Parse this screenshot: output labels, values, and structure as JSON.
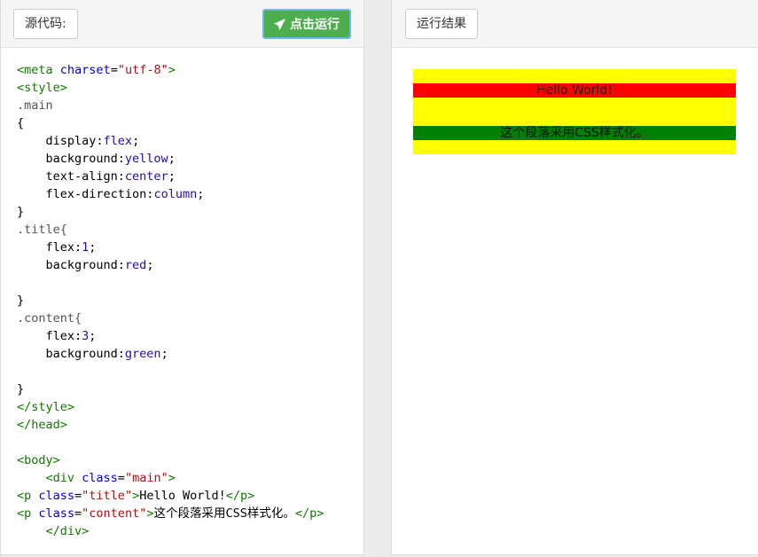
{
  "left_panel": {
    "source_label": "源代码:",
    "run_label": "点击运行",
    "code": {
      "l1_a": "<meta ",
      "l1_b": "charset",
      "l1_c": "=",
      "l1_d": "\"utf-8\"",
      "l1_e": ">",
      "l2": "<style>",
      "l3": ".main",
      "l4": "{",
      "l5_a": "    display:",
      "l5_b": "flex",
      "l5_c": ";",
      "l6_a": "    background:",
      "l6_b": "yellow",
      "l6_c": ";",
      "l7_a": "    text-align:",
      "l7_b": "center",
      "l7_c": ";",
      "l8_a": "    flex-direction:",
      "l8_b": "column",
      "l8_c": ";",
      "l9": "}",
      "l10": ".title{",
      "l11_a": "    flex:",
      "l11_b": "1",
      "l11_c": ";",
      "l12_a": "    background:",
      "l12_b": "red",
      "l12_c": ";",
      "l14": "}",
      "l15": ".content{",
      "l16_a": "    flex:",
      "l16_b": "3",
      "l16_c": ";",
      "l17_a": "    background:",
      "l17_b": "green",
      "l17_c": ";",
      "l19": "}",
      "l20": "</style>",
      "l21": "</head>",
      "l23": "<body>",
      "l24_a": "    <div ",
      "l24_b": "class",
      "l24_c": "=",
      "l24_d": "\"main\"",
      "l24_e": ">",
      "l25_a": "<p ",
      "l25_b": "class",
      "l25_c": "=",
      "l25_d": "\"title\"",
      "l25_e": ">",
      "l25_f": "Hello World!",
      "l25_g": "</p>",
      "l26_a": "<p ",
      "l26_b": "class",
      "l26_c": "=",
      "l26_d": "\"content\"",
      "l26_e": ">",
      "l26_f": "这个段落采用CSS样式化。",
      "l26_g": "</p>",
      "l27": "    </div>"
    }
  },
  "right_panel": {
    "result_label": "运行结果",
    "title_text": "Hello World!",
    "content_text": "这个段落采用CSS样式化。"
  },
  "colors": {
    "run_button": "#4cae4c",
    "result_bg": "yellow",
    "title_bg": "red",
    "content_bg": "green"
  },
  "icons": {
    "run": "paper-plane-icon"
  }
}
